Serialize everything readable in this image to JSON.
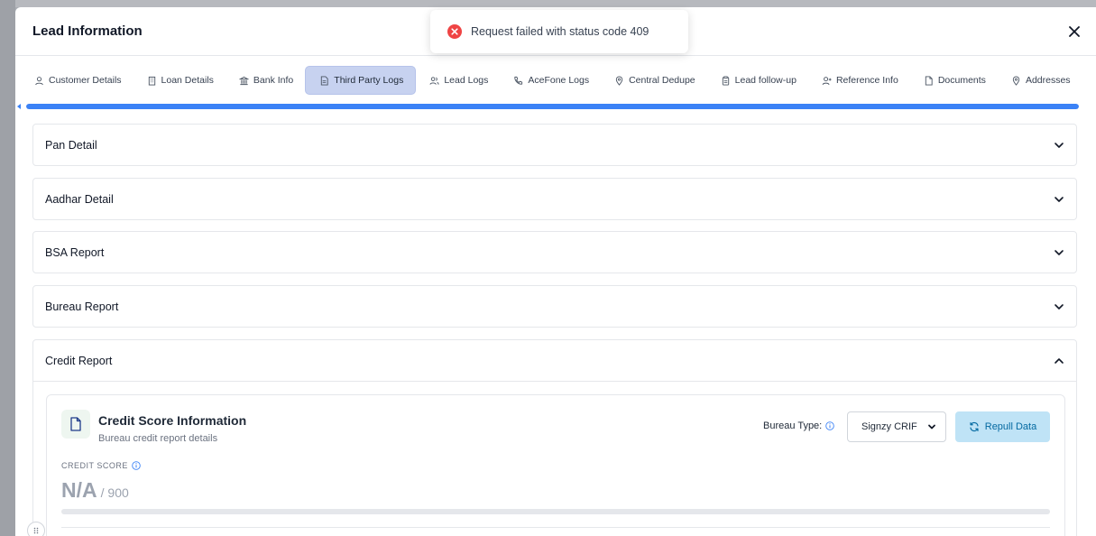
{
  "toast": {
    "message": "Request failed with status code 409",
    "icon": "error-circle-icon",
    "color": "#ef4444"
  },
  "modal": {
    "title": "Lead Information"
  },
  "tabs": [
    {
      "label": "Customer Details",
      "icon": "user-icon"
    },
    {
      "label": "Loan Details",
      "icon": "building-icon"
    },
    {
      "label": "Bank Info",
      "icon": "bank-icon"
    },
    {
      "label": "Third Party Logs",
      "icon": "document-icon",
      "active": true
    },
    {
      "label": "Lead Logs",
      "icon": "users-icon"
    },
    {
      "label": "AceFone Logs",
      "icon": "phone-icon"
    },
    {
      "label": "Central Dedupe",
      "icon": "location-pin-icon"
    },
    {
      "label": "Lead follow-up",
      "icon": "clipboard-icon"
    },
    {
      "label": "Reference Info",
      "icon": "user-plus-icon"
    },
    {
      "label": "Documents",
      "icon": "file-icon"
    },
    {
      "label": "Addresses",
      "icon": "location-pin-icon"
    }
  ],
  "tab_scroll_progress": 1.0,
  "accordions": [
    {
      "title": "Pan Detail",
      "expanded": false
    },
    {
      "title": "Aadhar Detail",
      "expanded": false
    },
    {
      "title": "BSA Report",
      "expanded": false
    },
    {
      "title": "Bureau Report",
      "expanded": false
    }
  ],
  "credit_report": {
    "title": "Credit Report",
    "expanded": true,
    "card": {
      "title": "Credit Score Information",
      "subtitle": "Bureau credit report details",
      "bureau_label": "Bureau Type:",
      "bureau_selected": "Signzy CRIF",
      "repull_label": "Repull Data",
      "score_label": "CREDIT SCORE",
      "score_value": "N/A",
      "score_max": "/ 900",
      "score_fraction": 0
    }
  },
  "colors": {
    "accent": "#3b82f6",
    "active_tab": "#c7d2f0",
    "repull_bg": "#bfe3f6",
    "repull_text": "#0369a1"
  }
}
